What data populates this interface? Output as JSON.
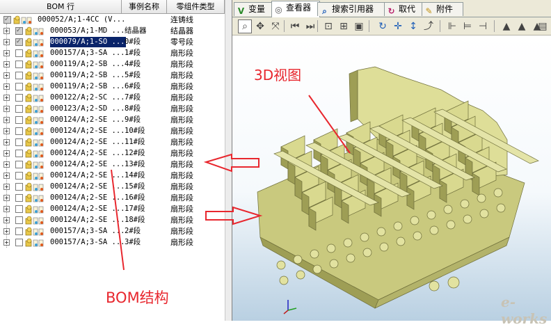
{
  "headers": {
    "bom_row": "BOM 行",
    "instance_name": "事例名称",
    "part_type": "零组件类型"
  },
  "rows": [
    {
      "id": "000052/A;1-4CC (V...",
      "instance": "",
      "type": "连铸线",
      "checked": true,
      "expander": "",
      "root": true
    },
    {
      "id": "000053/A;1-MD ...",
      "instance": "结晶器",
      "type": "结晶器",
      "checked": true,
      "expander": "+"
    },
    {
      "id": "000079/A;1-SO ...",
      "instance": "0#段",
      "type": "零号段",
      "checked": true,
      "expander": "+",
      "selected": true
    },
    {
      "id": "000157/A;3-SA ...",
      "instance": "1#段",
      "type": "扇形段",
      "checked": false,
      "expander": "+"
    },
    {
      "id": "000119/A;2-SB ...",
      "instance": "4#段",
      "type": "扇形段",
      "checked": false,
      "expander": "+"
    },
    {
      "id": "000119/A;2-SB ...",
      "instance": "5#段",
      "type": "扇形段",
      "checked": false,
      "expander": "+"
    },
    {
      "id": "000119/A;2-SB ...",
      "instance": "6#段",
      "type": "扇形段",
      "checked": false,
      "expander": "+"
    },
    {
      "id": "000122/A;2-SC ...",
      "instance": "7#段",
      "type": "扇形段",
      "checked": false,
      "expander": "+"
    },
    {
      "id": "000123/A;2-SD ...",
      "instance": "8#段",
      "type": "扇形段",
      "checked": false,
      "expander": "+"
    },
    {
      "id": "000124/A;2-SE ...",
      "instance": "9#段",
      "type": "扇形段",
      "checked": false,
      "expander": "+"
    },
    {
      "id": "000124/A;2-SE ...",
      "instance": "10#段",
      "type": "扇形段",
      "checked": false,
      "expander": "+"
    },
    {
      "id": "000124/A;2-SE ...",
      "instance": "11#段",
      "type": "扇形段",
      "checked": false,
      "expander": "+"
    },
    {
      "id": "000124/A;2-SE ...",
      "instance": "12#段",
      "type": "扇形段",
      "checked": false,
      "expander": "+"
    },
    {
      "id": "000124/A;2-SE ...",
      "instance": "13#段",
      "type": "扇形段",
      "checked": false,
      "expander": "+"
    },
    {
      "id": "000124/A;2-SE ...",
      "instance": "14#段",
      "type": "扇形段",
      "checked": false,
      "expander": "+"
    },
    {
      "id": "000124/A;2-SE ...",
      "instance": "15#段",
      "type": "扇形段",
      "checked": false,
      "expander": "+"
    },
    {
      "id": "000124/A;2-SE ...",
      "instance": "16#段",
      "type": "扇形段",
      "checked": false,
      "expander": "+"
    },
    {
      "id": "000124/A;2-SE ...",
      "instance": "17#段",
      "type": "扇形段",
      "checked": false,
      "expander": "+"
    },
    {
      "id": "000124/A;2-SE ...",
      "instance": "18#段",
      "type": "扇形段",
      "checked": false,
      "expander": "+"
    },
    {
      "id": "000157/A;3-SA ...",
      "instance": "2#段",
      "type": "扇形段",
      "checked": false,
      "expander": "+"
    },
    {
      "id": "000157/A;3-SA ...",
      "instance": "3#段",
      "type": "扇形段",
      "checked": false,
      "expander": "+"
    }
  ],
  "tabs": [
    {
      "label": "变量",
      "icon": "variable-icon"
    },
    {
      "label": "查看器",
      "icon": "viewer-icon",
      "active": true
    },
    {
      "label": "搜索引用器",
      "icon": "search-reference-icon"
    },
    {
      "label": "取代",
      "icon": "replace-icon"
    },
    {
      "label": "附件",
      "icon": "attachment-icon"
    }
  ],
  "toolbar_icons": [
    "zoom-icon",
    "pan-icon",
    "rotate-icon",
    "first-icon",
    "next-icon",
    "fit-icon",
    "zoom-window-icon",
    "view-icon",
    "refresh-icon",
    "move-icon",
    "vertical-icon",
    "spin-icon",
    "section-1-icon",
    "section-2-icon",
    "section-3-icon",
    "display-1-icon",
    "display-2-icon",
    "display-3-icon",
    "properties-icon"
  ],
  "annotations": {
    "view_label": "3D视图",
    "bom_label": "BOM结构"
  },
  "watermark": "e-works",
  "colors": {
    "annotation": "#e8272e",
    "selection": "#0a246a",
    "model": "#d9d98f",
    "model_dark": "#9e9e55"
  }
}
